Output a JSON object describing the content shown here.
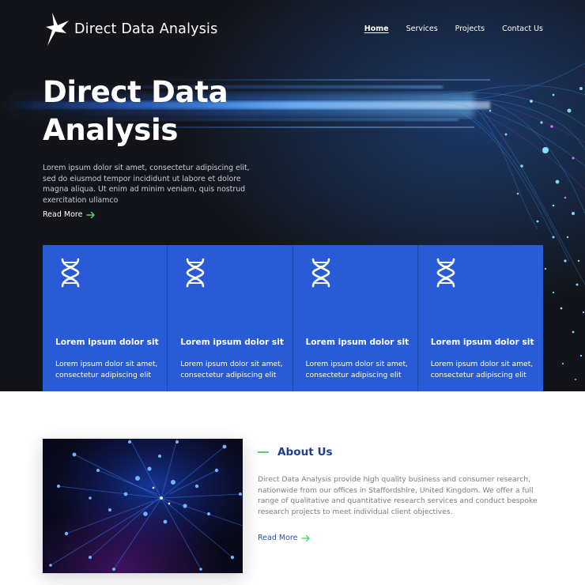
{
  "brand": {
    "name": "Direct Data Analysis",
    "logo_icon": "bird-logo-icon"
  },
  "nav": {
    "items": [
      {
        "label": "Home",
        "active": true
      },
      {
        "label": "Services"
      },
      {
        "label": "Projects"
      },
      {
        "label": "Contact Us"
      }
    ]
  },
  "hero": {
    "title_line1": "Direct Data",
    "title_line2": "Analysis",
    "description": "Lorem ipsum dolor sit amet, consectetur adipiscing elit, sed do eiusmod tempor incididunt ut labore et dolore magna aliqua. Ut enim ad minim veniam, quis nostrud exercitation ullamco",
    "cta_label": "Read More",
    "cta_icon": "arrow-right-icon"
  },
  "cards": [
    {
      "icon": "dna-icon",
      "title": "Lorem ipsum dolor sit",
      "text": "Lorem ipsum dolor sit amet, consectetur adipiscing elit"
    },
    {
      "icon": "dna-icon",
      "title": "Lorem ipsum dolor sit",
      "text": "Lorem ipsum dolor sit amet, consectetur adipiscing elit"
    },
    {
      "icon": "dna-icon",
      "title": "Lorem ipsum dolor sit",
      "text": "Lorem ipsum dolor sit amet, consectetur adipiscing elit"
    },
    {
      "icon": "dna-icon",
      "title": "Lorem ipsum dolor sit",
      "text": "Lorem ipsum dolor sit amet, consectetur adipiscing elit"
    }
  ],
  "about": {
    "title": "About Us",
    "text": "Direct Data Analysis provide high quality business and consumer research, nationwide from our offices in Staffordshire, United Kingdom. We offer a full range of qualitative and quantitative research services and conduct bespoke research projects to meet individual client objectives.",
    "cta_label": "Read More"
  },
  "colors": {
    "hero_bg": "#131419",
    "card_blue": "#2a5bd7",
    "accent_green": "#5ad26b",
    "about_title": "#1e3f8d",
    "link_blue": "#2a4fb0"
  }
}
